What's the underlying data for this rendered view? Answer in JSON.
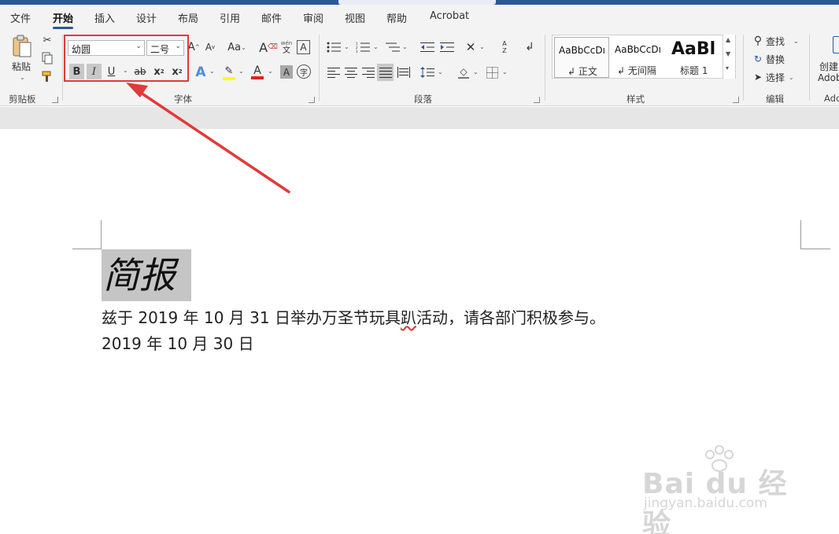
{
  "tabs": [
    {
      "label": "文件"
    },
    {
      "label": "开始"
    },
    {
      "label": "插入"
    },
    {
      "label": "设计"
    },
    {
      "label": "布局"
    },
    {
      "label": "引用"
    },
    {
      "label": "邮件"
    },
    {
      "label": "审阅"
    },
    {
      "label": "视图"
    },
    {
      "label": "帮助"
    },
    {
      "label": "Acrobat"
    }
  ],
  "clipboard": {
    "paste_label": "粘贴",
    "group_label": "剪贴板"
  },
  "font": {
    "font_name": "幼圆",
    "font_size": "二号",
    "group_label": "字体",
    "grow_label": "A",
    "shrink_label": "A",
    "case_label": "Aa",
    "bold": "B",
    "italic": "I",
    "underline": "U",
    "strike": "ab",
    "subscript": "x",
    "superscript": "x",
    "phonetic_top": "wén",
    "phonetic_bottom": "文",
    "border_char": "A",
    "effects": "A",
    "font_color": "A",
    "shading": "A",
    "enclose": "字"
  },
  "paragraph": {
    "group_label": "段落"
  },
  "styles": {
    "group_label": "样式",
    "items": [
      {
        "sample": "AaBbCcDı",
        "name": "↲ 正文"
      },
      {
        "sample": "AaBbCcDı",
        "name": "↲ 无间隔"
      },
      {
        "sample": "AaBl",
        "name": "标题 1"
      }
    ]
  },
  "editing": {
    "find": "查找",
    "replace": "替换",
    "select": "选择",
    "group_label": "编辑"
  },
  "adobe": {
    "create": "创建",
    "adobe": "Adob",
    "group": "Ado"
  },
  "document": {
    "heading": "简报",
    "line1_pre": "兹于 2019 年 10 月 31 日举办万圣节玩具",
    "line1_squig": "趴",
    "line1_post": "活动，请各部门积极参与。",
    "line2": "2019 年 10 月 30 日"
  },
  "watermark": {
    "brand": "Bai du 经验",
    "url": "jingyan.baidu.com"
  },
  "colors": {
    "accent": "#2b579a",
    "highlight_box": "#e03a3a",
    "font_color_bar": "#e02020",
    "highlight_bar": "#ffff00"
  }
}
